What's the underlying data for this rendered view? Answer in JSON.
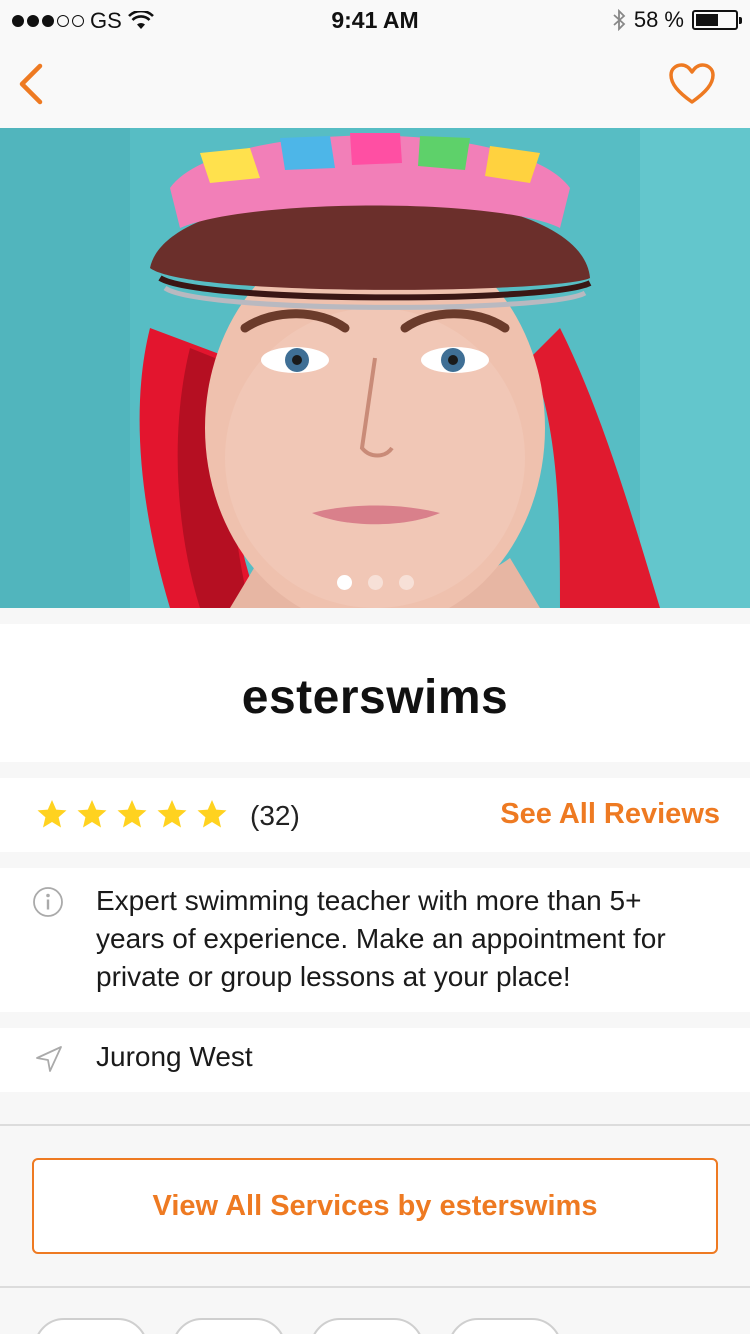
{
  "status_bar": {
    "carrier": "GS",
    "time": "9:41 AM",
    "battery": "58 %",
    "battery_level": 0.58
  },
  "nav": {
    "back_icon": "chevron-left-icon",
    "favorite_icon": "heart-outline-icon"
  },
  "hero": {
    "page_count": 3,
    "active_page": 1
  },
  "profile": {
    "username": "esterswims"
  },
  "rating": {
    "stars": 5,
    "count_label": "(32)",
    "see_all_label": "See All Reviews"
  },
  "description": {
    "text": "Expert swimming teacher with more than 5+ years of experience. Make an appointment for private or group lessons at your place!"
  },
  "location": {
    "text": "Jurong West"
  },
  "services_button": {
    "label": "View All Services by esterswims"
  },
  "colors": {
    "accent": "#ee7a22",
    "star": "#ffd21f"
  }
}
